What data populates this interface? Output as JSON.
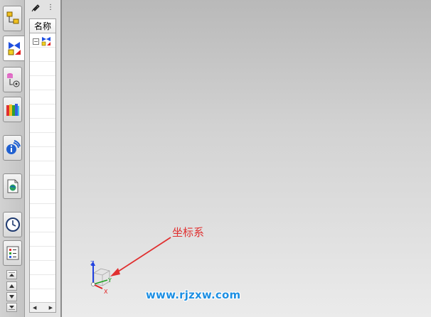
{
  "navigator": {
    "column_header": "名称",
    "tree_expander": "−",
    "menu_dots": "⋮",
    "scroll_left": "◀",
    "scroll_right": "▶"
  },
  "graphics": {
    "annotation": "坐标系",
    "axis_x": "X",
    "axis_y": "Y",
    "axis_z": "Z",
    "watermark": "www.rjzxw.com"
  },
  "colors": {
    "annotation": "#e03030",
    "axis_x": "#e02020",
    "axis_y": "#20a020",
    "axis_z": "#2040e0",
    "watermark": "#1d8fe3"
  }
}
